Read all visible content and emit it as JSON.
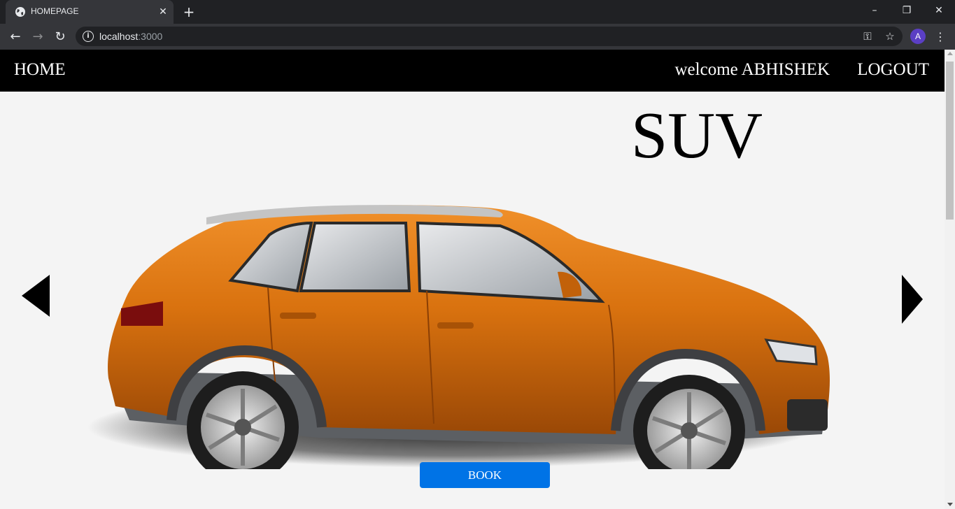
{
  "browser": {
    "tab_title": "HOMEPAGE",
    "url_host": "localhost",
    "url_port": ":3000",
    "profile_initial": "A"
  },
  "navbar": {
    "home_label": "HOME",
    "welcome_text": "welcome ABHISHEK",
    "logout_label": "LOGOUT"
  },
  "carousel": {
    "title": "SUV",
    "book_label": "BOOK",
    "car_color": "#d9720f"
  },
  "colors": {
    "navbar_bg": "#000000",
    "page_bg": "#f4f4f4",
    "book_button": "#0073e6"
  },
  "icons": {
    "tab_favicon": "globe-icon",
    "prev": "triangle-left-icon",
    "next": "triangle-right-icon"
  }
}
